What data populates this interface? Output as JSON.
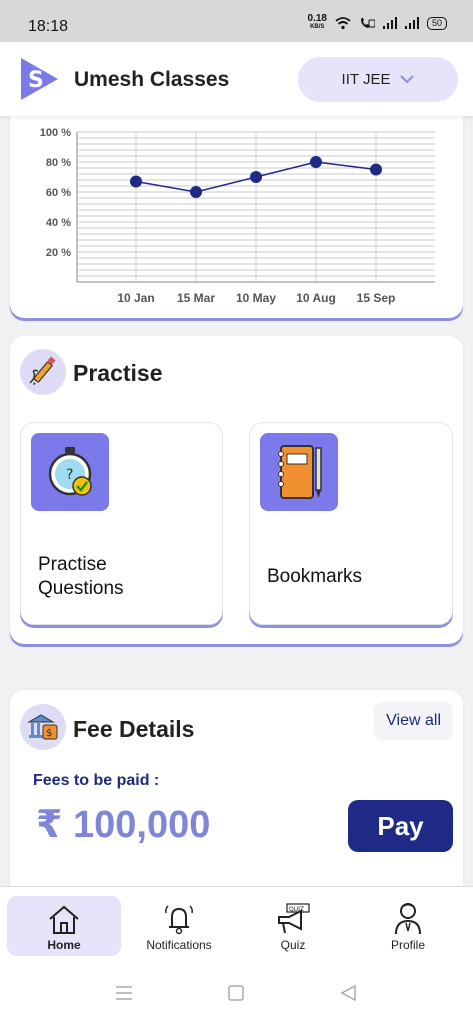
{
  "status_bar": {
    "time": "18:18",
    "net_speed": "0.18",
    "net_unit": "KB/S",
    "battery": "50"
  },
  "header": {
    "app_name": "Umesh Classes",
    "course_selector": "IIT JEE",
    "logo_letter": "S"
  },
  "chart_data": {
    "type": "line",
    "categories": [
      "10 Jan",
      "15 Mar",
      "10 May",
      "10 Aug",
      "15 Sep"
    ],
    "values": [
      67,
      60,
      70,
      80,
      75
    ],
    "ylim": [
      0,
      100
    ],
    "y_ticks": [
      "20 %",
      "40 %",
      "60 %",
      "80 %",
      "100 %"
    ],
    "grid": true,
    "color": "#1e2a86"
  },
  "practise": {
    "title": "Practise",
    "tiles": [
      {
        "label_line1": "Practise",
        "label_line2": "Questions",
        "icon": "stopwatch-icon"
      },
      {
        "label_line1": "Bookmarks",
        "label_line2": "",
        "icon": "notebook-icon"
      }
    ]
  },
  "fee": {
    "title": "Fee Details",
    "view_all": "View all",
    "due_label": "Fees to be paid :",
    "amount": "₹ 100,000",
    "pay": "Pay"
  },
  "bottom_nav": [
    {
      "label": "Home",
      "icon": "home-icon",
      "active": true
    },
    {
      "label": "Notifications",
      "icon": "bell-icon",
      "active": false
    },
    {
      "label": "Quiz",
      "icon": "megaphone-icon",
      "active": false
    },
    {
      "label": "Profile",
      "icon": "user-icon",
      "active": false
    }
  ],
  "colors": {
    "accent": "#7c79ea",
    "primary": "#1e2a86",
    "chip": "#e5e4fa"
  }
}
